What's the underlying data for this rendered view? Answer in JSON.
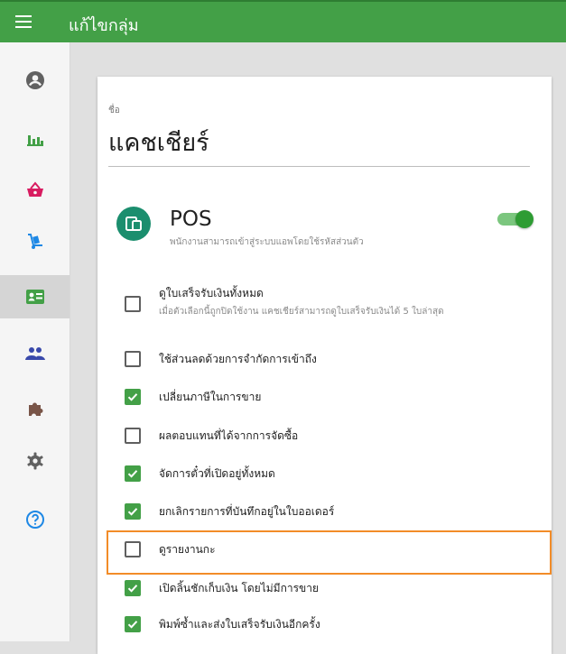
{
  "app_bar": {
    "title": "แก้ไขกลุ่ม",
    "menu_icon": "hamburger-icon"
  },
  "nav_rail": {
    "items": [
      {
        "name": "account",
        "icon": "account-circle-icon"
      },
      {
        "name": "reports",
        "icon": "bar-chart-icon"
      },
      {
        "name": "items",
        "icon": "shopping-basket-icon"
      },
      {
        "name": "inventory",
        "icon": "hand-truck-icon"
      },
      {
        "name": "employees",
        "icon": "badge-icon",
        "active": true
      },
      {
        "name": "customers",
        "icon": "people-icon"
      },
      {
        "name": "integrations",
        "icon": "puzzle-icon"
      },
      {
        "name": "settings",
        "icon": "gear-icon"
      },
      {
        "name": "help",
        "icon": "help-circle-icon"
      }
    ]
  },
  "form": {
    "name_label": "ชื่อ",
    "name_value": "แคชเชียร์",
    "pos": {
      "title": "POS",
      "description": "พนักงานสามารถเข้าสู่ระบบแอพโดยใช้รหัสส่วนตัว",
      "enabled": true
    },
    "permissions": [
      {
        "label": "ดูใบเสร็จรับเงินทั้งหมด",
        "description": "เมื่อตัวเลือกนี้ถูกปิดใช้งาน แคชเชียร์สามารถดูใบเสร็จรับเงินได้ 5 ใบล่าสุด",
        "checked": false
      },
      {
        "label": "ใช้ส่วนลดด้วยการจำกัดการเข้าถึง",
        "checked": false
      },
      {
        "label": "เปลี่ยนภาษีในการขาย",
        "checked": true
      },
      {
        "label": "ผลตอบแทนที่ได้จากการจัดซื้อ",
        "checked": false
      },
      {
        "label": "จัดการตั๋วที่เปิดอยู่ทั้งหมด",
        "checked": true
      },
      {
        "label": "ยกเลิกรายการที่บันทึกอยู่ในใบออเดอร์",
        "checked": true
      },
      {
        "label": "ดูรายงานกะ",
        "checked": false
      },
      {
        "label": "เปิดลิ้นชักเก็บเงิน โดยไม่มีการขาย",
        "checked": true
      },
      {
        "label": "พิมพ์ซ้ำและส่งใบเสร็จรับเงินอีกครั้ง",
        "checked": true
      }
    ]
  },
  "colors": {
    "primary": "#43a047",
    "highlight": "#f28c28",
    "pos_icon": "#1b8e6e"
  }
}
